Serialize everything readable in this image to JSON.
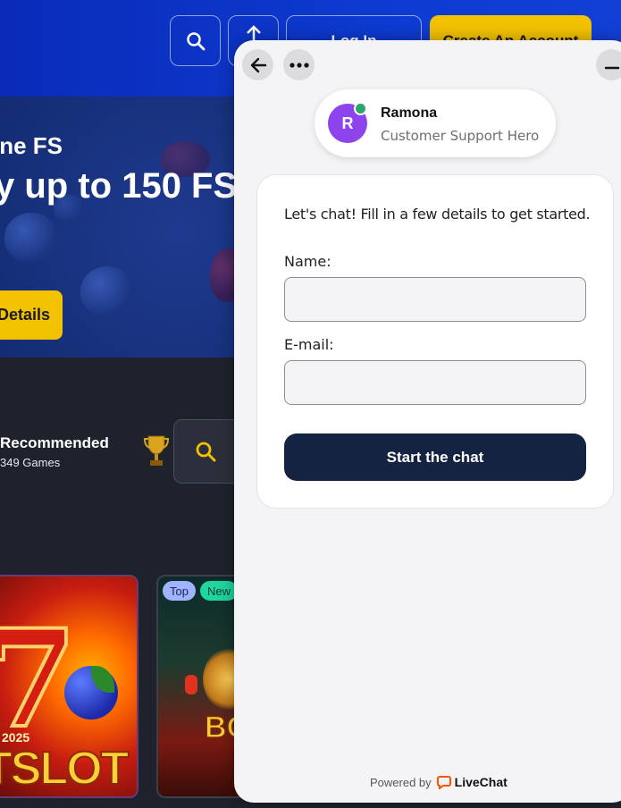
{
  "site": {
    "header": {
      "login_label": "Log In",
      "create_account_label": "Create An Account"
    },
    "banner": {
      "subtitle": "ine FS",
      "title": "y up to 150 FS",
      "details_label": "Details"
    },
    "games": {
      "section_title": "Recommended",
      "count": "349 Games",
      "cards": [
        {
          "year": "2025",
          "name": "TSLOT"
        },
        {
          "name": "BO"
        }
      ],
      "badges": [
        "Top",
        "New"
      ]
    }
  },
  "chat": {
    "agent": {
      "initial": "R",
      "name": "Ramona",
      "role": "Customer Support Hero",
      "status_color": "#2aa56b",
      "avatar_color": "#8e44ec"
    },
    "form": {
      "intro": "Let's chat! Fill in a few details to get started.",
      "name_label": "Name:",
      "name_value": "",
      "email_label": "E-mail:",
      "email_value": "",
      "submit_label": "Start the chat"
    },
    "footer": {
      "powered_by": "Powered by",
      "brand": "LiveChat",
      "brand_color": "#ff5100"
    }
  }
}
